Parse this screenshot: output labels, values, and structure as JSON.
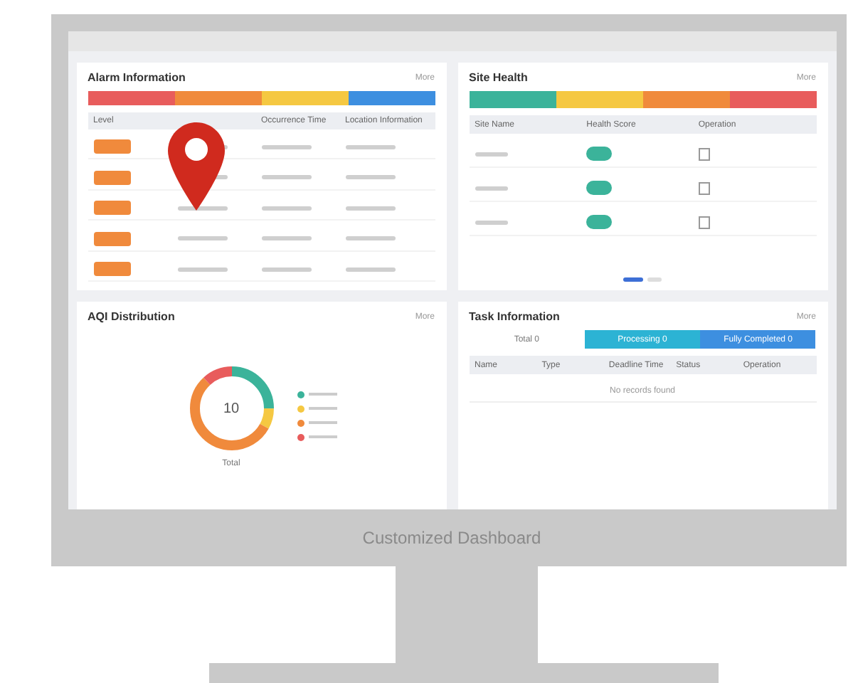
{
  "alarm": {
    "title": "Alarm Information",
    "more": "More",
    "levels": [
      {
        "color": "#e85c5c"
      },
      {
        "color": "#f08a3c"
      },
      {
        "color": "#f5c842"
      },
      {
        "color": "#3d8fe0"
      }
    ],
    "columns": [
      "Level",
      "Occurrence Time",
      "Location Information"
    ],
    "rows": [
      {
        "color": "#f08a3c"
      },
      {
        "color": "#f08a3c"
      },
      {
        "color": "#f08a3c"
      },
      {
        "color": "#f08a3c"
      },
      {
        "color": "#f08a3c"
      }
    ]
  },
  "site_health": {
    "title": "Site Health",
    "more": "More",
    "levels": [
      {
        "color": "#3bb39a"
      },
      {
        "color": "#f5c842"
      },
      {
        "color": "#f08a3c"
      },
      {
        "color": "#e85c5c"
      }
    ],
    "columns": [
      "Site Name",
      "Health Score",
      "Operation"
    ],
    "rows": [
      {
        "color": "#3bb39a"
      },
      {
        "color": "#3bb39a"
      },
      {
        "color": "#3bb39a"
      }
    ]
  },
  "aqi": {
    "title": "AQI Distribution",
    "more": "More",
    "center": "10",
    "caption": "Total",
    "legend": [
      {
        "color": "#3bb39a"
      },
      {
        "color": "#f5c842"
      },
      {
        "color": "#f08a3c"
      },
      {
        "color": "#e85c5c"
      }
    ]
  },
  "task": {
    "title": "Task Information",
    "more": "More",
    "tabs": [
      {
        "label": "Total 0",
        "color": "#ffffff"
      },
      {
        "label": "Processing 0",
        "color": "#2cb3d4"
      },
      {
        "label": "Fully Completed 0",
        "color": "#3d8fe0"
      }
    ],
    "columns": [
      "Name",
      "Type",
      "Deadline Time",
      "Status",
      "Operation"
    ],
    "empty": "No records found"
  },
  "caption": "Customized Dashboard"
}
